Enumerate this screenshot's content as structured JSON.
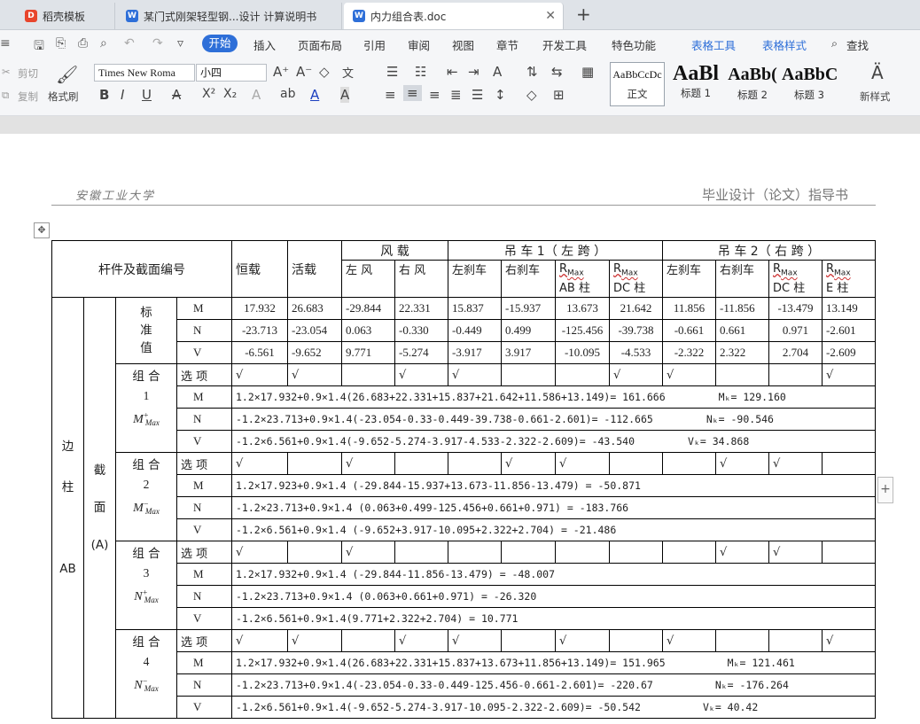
{
  "tabs": [
    {
      "label": "稻壳模板",
      "icon": "wps-logo-icon"
    },
    {
      "label": "某门式刚架轻型钢...设计 计算说明书",
      "icon": "word-doc-icon"
    },
    {
      "label": "内力组合表.doc",
      "icon": "word-doc-icon"
    }
  ],
  "menu": [
    "开始",
    "插入",
    "页面布局",
    "引用",
    "审阅",
    "视图",
    "章节",
    "开发工具",
    "特色功能",
    "表格工具",
    "表格样式",
    "查找"
  ],
  "ribbon": {
    "cut": "剪切",
    "copy": "复制",
    "format_painter": "格式刷",
    "font": "Times New Roma",
    "size": "小四",
    "styles": [
      {
        "preview": "AaBbCcDc",
        "name": "正文"
      },
      {
        "preview": "AaBl",
        "name": "标题 1"
      },
      {
        "preview": "AaBb(",
        "name": "标题 2"
      },
      {
        "preview": "AaBbC",
        "name": "标题 3"
      }
    ],
    "new_style": "新样式"
  },
  "page_header": {
    "left": "安徽工业大学",
    "right": "毕业设计（论文）指导书"
  },
  "table": {
    "head": {
      "member": "杆件及截面编号",
      "dead": "恒载",
      "live": "活载",
      "wind": "风 载",
      "wind_left": "左 风",
      "wind_right": "右 风",
      "crane1": "吊 车 1（ 左 跨 ）",
      "crane2": "吊 车 2（ 右 跨 ）",
      "brake_left": "左刹车",
      "brake_right": "右刹车",
      "rmax": "R",
      "rmax_sub": "Max",
      "ab_col": "AB 柱",
      "dc_col": "DC 柱",
      "e_col": "E 柱"
    },
    "member_label": [
      "边",
      "柱",
      "AB"
    ],
    "section_label": [
      "截",
      "面",
      "(A)"
    ],
    "std_label": [
      "标",
      "准",
      "值"
    ],
    "std": [
      {
        "f": "M",
        "v": [
          "17.932",
          "26.683",
          "-29.844",
          "22.331",
          "15.837",
          "-15.937",
          "13.673",
          "21.642",
          "11.856",
          "-11.856",
          "-13.479",
          "13.149"
        ]
      },
      {
        "f": "N",
        "v": [
          "-23.713",
          "-23.054",
          "0.063",
          "-0.330",
          "-0.449",
          "0.499",
          "-125.456",
          "-39.738",
          "-0.661",
          "0.661",
          "0.971",
          "-2.601"
        ]
      },
      {
        "f": "V",
        "v": [
          "-6.561",
          "-9.652",
          "9.771",
          "-5.274",
          "-3.917",
          "3.917",
          "-10.095",
          "-4.533",
          "-2.322",
          "2.322",
          "2.704",
          "-2.609"
        ]
      }
    ],
    "select_label": "选 项",
    "check": "√",
    "combos": [
      {
        "title": "组 合",
        "num": "1",
        "sym": "M",
        "sup": "+",
        "sub": "Max",
        "checks": [
          1,
          1,
          0,
          1,
          1,
          0,
          0,
          1,
          1,
          0,
          0,
          1
        ],
        "rows": [
          {
            "f": "M",
            "expr": "1.2×17.932+0.9×1.4(26.683+22.331+15.837+21.642+11.586+13.149)= 161.666",
            "note": "Mₖ= 129.160"
          },
          {
            "f": "N",
            "expr": "-1.2×23.713+0.9×1.4(-23.054-0.33-0.449-39.738-0.661-2.601)= -112.665",
            "note": "Nₖ= -90.546"
          },
          {
            "f": "V",
            "expr": "-1.2×6.561+0.9×1.4(-9.652-5.274-3.917-4.533-2.322-2.609)= -43.540",
            "note": "Vₖ= 34.868"
          }
        ]
      },
      {
        "title": "组 合",
        "num": "2",
        "sym": "M",
        "sup": "−",
        "sub": "Max",
        "checks": [
          1,
          0,
          1,
          0,
          0,
          1,
          1,
          0,
          0,
          1,
          1,
          0
        ],
        "rows": [
          {
            "f": "M",
            "expr": "1.2×17.923+0.9×1.4 (-29.844-15.937+13.673-11.856-13.479) = -50.871",
            "note": ""
          },
          {
            "f": "N",
            "expr": "-1.2×23.713+0.9×1.4 (0.063+0.499-125.456+0.661+0.971) = -183.766",
            "note": ""
          },
          {
            "f": "V",
            "expr": "-1.2×6.561+0.9×1.4 (-9.652+3.917-10.095+2.322+2.704) = -21.486",
            "note": ""
          }
        ]
      },
      {
        "title": "组 合",
        "num": "3",
        "sym": "N",
        "sup": "+",
        "sub": "Max",
        "checks": [
          1,
          0,
          1,
          0,
          0,
          0,
          0,
          0,
          0,
          1,
          1,
          0
        ],
        "rows": [
          {
            "f": "M",
            "expr": "1.2×17.932+0.9×1.4 (-29.844-11.856-13.479) = -48.007",
            "note": ""
          },
          {
            "f": "N",
            "expr": "-1.2×23.713+0.9×1.4 (0.063+0.661+0.971) = -26.320",
            "note": ""
          },
          {
            "f": "V",
            "expr": "-1.2×6.561+0.9×1.4(9.771+2.322+2.704) = 10.771",
            "note": ""
          }
        ]
      },
      {
        "title": "组 合",
        "num": "4",
        "sym": "N",
        "sup": "−",
        "sub": "Max",
        "checks": [
          1,
          1,
          0,
          1,
          1,
          0,
          1,
          0,
          1,
          0,
          0,
          1
        ],
        "rows": [
          {
            "f": "M",
            "expr": "1.2×17.932+0.9×1.4(26.683+22.331+15.837+13.673+11.856+13.149)= 151.965",
            "note": "Mₖ= 121.461"
          },
          {
            "f": "N",
            "expr": "-1.2×23.713+0.9×1.4(-23.054-0.33-0.449-125.456-0.661-2.601)= -220.67",
            "note": "Nₖ= -176.264"
          },
          {
            "f": "V",
            "expr": "-1.2×6.561+0.9×1.4(-9.652-5.274-3.917-10.095-2.322-2.609)= -50.542",
            "note": "Vₖ= 40.42"
          }
        ]
      }
    ]
  }
}
